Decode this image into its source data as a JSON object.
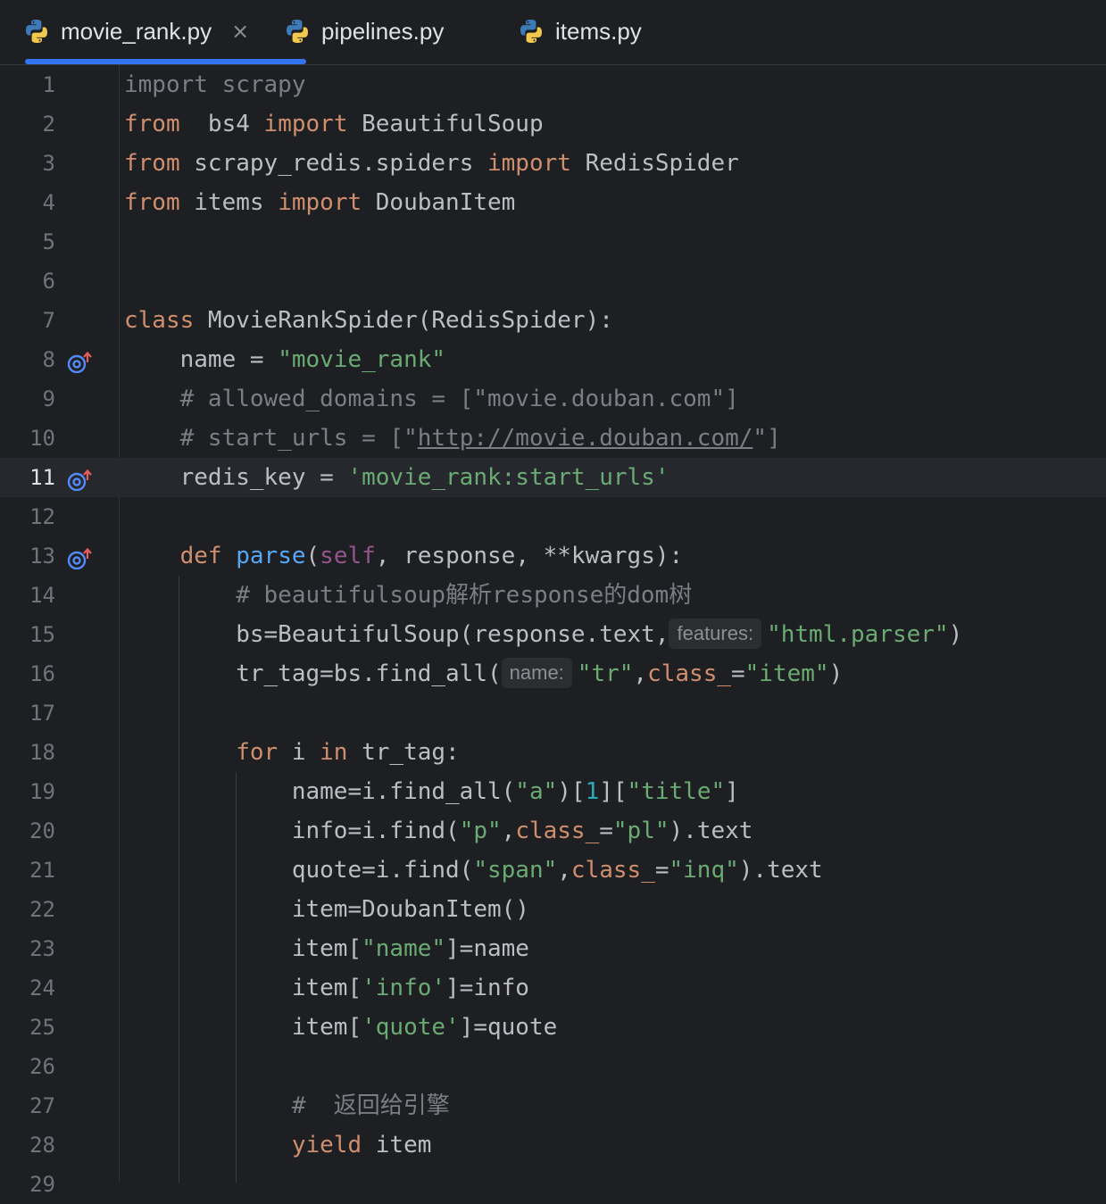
{
  "tabs": [
    {
      "label": "movie_rank.py",
      "active": true,
      "closable": true,
      "icon": "python-icon"
    },
    {
      "label": "pipelines.py",
      "active": false,
      "icon": "python-icon"
    },
    {
      "label": "items.py",
      "active": false,
      "icon": "python-icon"
    }
  ],
  "tab_close_glyph": "×",
  "colors": {
    "background": "#1e1f22",
    "keyword": "#cf8e6d",
    "string": "#6aab73",
    "comment": "#7a7e85",
    "function": "#56a8f5",
    "active_tab_underline": "#3574f0"
  },
  "editor": {
    "current_line": 11,
    "lines": [
      {
        "n": "1",
        "tokens": [
          [
            "cm",
            "import scrapy"
          ]
        ]
      },
      {
        "n": "2",
        "tokens": [
          [
            "kw",
            "from"
          ],
          [
            "",
            "  bs4 "
          ],
          [
            "kw",
            "import"
          ],
          [
            "",
            " BeautifulSoup"
          ]
        ]
      },
      {
        "n": "3",
        "tokens": [
          [
            "kw",
            "from"
          ],
          [
            "",
            " scrapy_redis.spiders "
          ],
          [
            "kw",
            "import"
          ],
          [
            "",
            " RedisSpider"
          ]
        ]
      },
      {
        "n": "4",
        "tokens": [
          [
            "kw",
            "from"
          ],
          [
            "",
            " items "
          ],
          [
            "kw",
            "import"
          ],
          [
            "",
            " DoubanItem"
          ]
        ]
      },
      {
        "n": "5",
        "tokens": []
      },
      {
        "n": "6",
        "tokens": []
      },
      {
        "n": "7",
        "tokens": [
          [
            "kw",
            "class"
          ],
          [
            "",
            " MovieRankSpider(RedisSpider):"
          ]
        ]
      },
      {
        "n": "8",
        "marker": true,
        "tokens": [
          [
            "",
            "    name = "
          ],
          [
            "str",
            "\"movie_rank\""
          ]
        ]
      },
      {
        "n": "9",
        "tokens": [
          [
            "cm",
            "    # allowed_domains = [\"movie.douban.com\"]"
          ]
        ]
      },
      {
        "n": "10",
        "tokens": [
          [
            "cm",
            "    # start_urls = [\""
          ],
          [
            "link",
            "http://movie.douban.com/"
          ],
          [
            "cm",
            "\"]"
          ]
        ]
      },
      {
        "n": "11",
        "marker": true,
        "tokens": [
          [
            "",
            "    redis_key = "
          ],
          [
            "str",
            "'movie_rank:start_urls'"
          ]
        ]
      },
      {
        "n": "12",
        "tokens": []
      },
      {
        "n": "13",
        "marker": true,
        "tokens": [
          [
            "kw",
            "    def"
          ],
          [
            "",
            " "
          ],
          [
            "fn",
            "parse"
          ],
          [
            "",
            "("
          ],
          [
            "self",
            "self"
          ],
          [
            "",
            ", response, **kwargs):"
          ]
        ]
      },
      {
        "n": "14",
        "tokens": [
          [
            "cm",
            "        # beautifulsoup解析response的dom树"
          ]
        ]
      },
      {
        "n": "15",
        "tokens": [
          [
            "",
            "        bs=BeautifulSoup(response.text,"
          ],
          [
            "hint",
            "features:"
          ],
          [
            "str",
            "\"html.parser\""
          ],
          [
            "",
            ")"
          ]
        ]
      },
      {
        "n": "16",
        "tokens": [
          [
            "",
            "        tr_tag=bs.find_all("
          ],
          [
            "hint",
            "name:"
          ],
          [
            "str",
            "\"tr\""
          ],
          [
            "",
            ","
          ],
          [
            "kw",
            "class_"
          ],
          [
            "",
            "="
          ],
          [
            "str",
            "\"item\""
          ],
          [
            "",
            ")"
          ]
        ]
      },
      {
        "n": "17",
        "tokens": []
      },
      {
        "n": "18",
        "tokens": [
          [
            "kw",
            "        for"
          ],
          [
            "",
            " i "
          ],
          [
            "kw",
            "in"
          ],
          [
            "",
            " tr_tag:"
          ]
        ]
      },
      {
        "n": "19",
        "tokens": [
          [
            "",
            "            name=i.find_all("
          ],
          [
            "str",
            "\"a\""
          ],
          [
            "",
            ")["
          ],
          [
            "num",
            "1"
          ],
          [
            "",
            "]["
          ],
          [
            "str",
            "\"title\""
          ],
          [
            "",
            "]"
          ]
        ]
      },
      {
        "n": "20",
        "tokens": [
          [
            "",
            "            info=i.find("
          ],
          [
            "str",
            "\"p\""
          ],
          [
            "",
            ","
          ],
          [
            "kw",
            "class_"
          ],
          [
            "",
            "="
          ],
          [
            "str",
            "\"pl\""
          ],
          [
            "",
            ").text"
          ]
        ]
      },
      {
        "n": "21",
        "tokens": [
          [
            "",
            "            quote=i.find("
          ],
          [
            "str",
            "\"span\""
          ],
          [
            "",
            ","
          ],
          [
            "kw",
            "class_"
          ],
          [
            "",
            "="
          ],
          [
            "str",
            "\"inq\""
          ],
          [
            "",
            ").text"
          ]
        ]
      },
      {
        "n": "22",
        "tokens": [
          [
            "",
            "            item=DoubanItem()"
          ]
        ]
      },
      {
        "n": "23",
        "tokens": [
          [
            "",
            "            item["
          ],
          [
            "str",
            "\"name\""
          ],
          [
            "",
            "]=name"
          ]
        ]
      },
      {
        "n": "24",
        "tokens": [
          [
            "",
            "            item["
          ],
          [
            "str",
            "'info'"
          ],
          [
            "",
            "]=info"
          ]
        ]
      },
      {
        "n": "25",
        "tokens": [
          [
            "",
            "            item["
          ],
          [
            "str",
            "'quote'"
          ],
          [
            "",
            "]=quote"
          ]
        ]
      },
      {
        "n": "26",
        "tokens": []
      },
      {
        "n": "27",
        "tokens": [
          [
            "cm",
            "            #  返回给引擎"
          ]
        ]
      },
      {
        "n": "28",
        "tokens": [
          [
            "kw",
            "            yield"
          ],
          [
            "",
            " item"
          ]
        ]
      },
      {
        "n": "29",
        "tokens": []
      }
    ]
  }
}
